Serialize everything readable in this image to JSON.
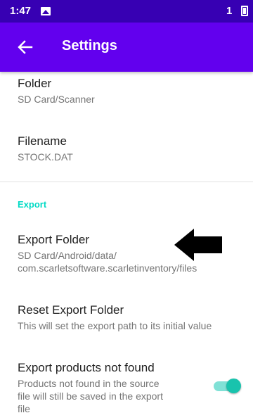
{
  "status_bar": {
    "time": "1:47",
    "sim": "1"
  },
  "app_bar": {
    "title": "Settings",
    "back_icon": "arrow-back-icon"
  },
  "preferences": {
    "folder": {
      "title": "Folder",
      "summary": "SD Card/Scanner"
    },
    "filename": {
      "title": "Filename",
      "summary": "STOCK.DAT"
    },
    "export_category": "Export",
    "export_folder": {
      "title": "Export Folder",
      "summary_line1": "SD Card/Android/data/",
      "summary_line2": "com.scarletsoftware.scarletinventory/files"
    },
    "reset_export_folder": {
      "title": "Reset Export Folder",
      "summary": "This will set the export path to its initial value"
    },
    "export_not_found": {
      "title": "Export products not found",
      "summary_line1": "Products not found in the source",
      "summary_line2": "file will still be saved in the export",
      "summary_line3": "file",
      "enabled": true
    }
  },
  "colors": {
    "status_bar": "#3700b3",
    "app_bar": "#6200ee",
    "accent": "#03dac5",
    "switch_on": "#19c3ad"
  }
}
